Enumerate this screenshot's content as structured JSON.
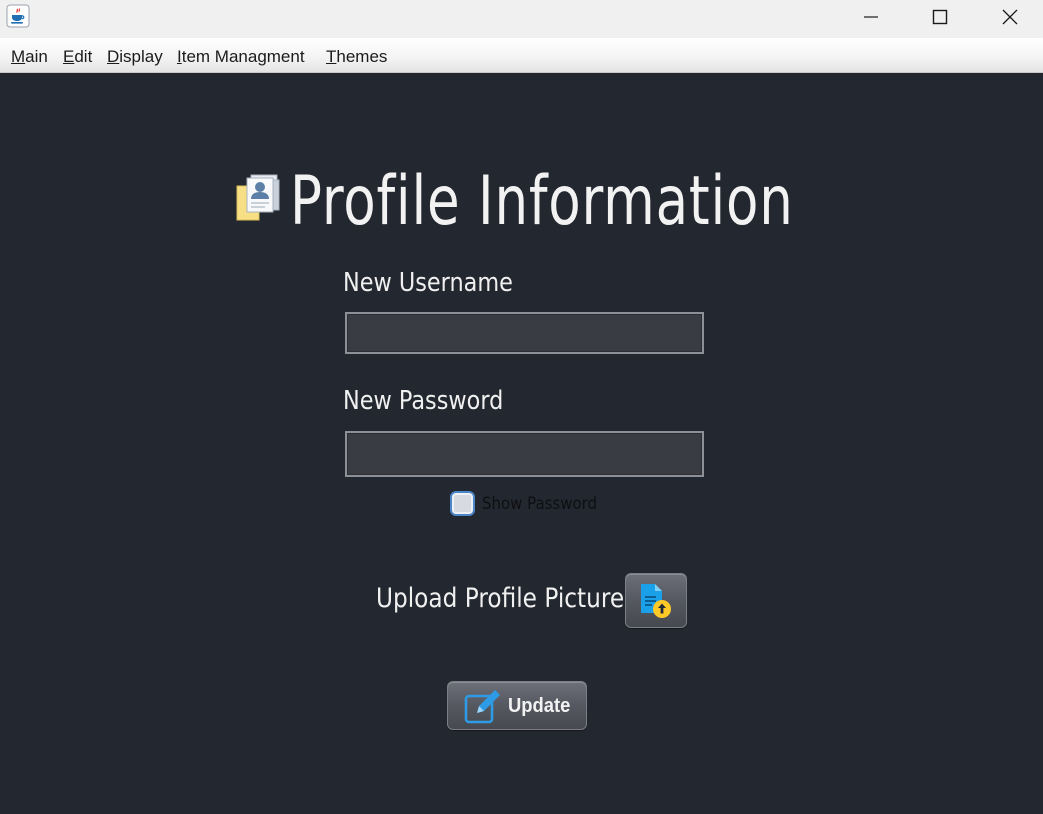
{
  "window": {
    "icon": "java-cup-icon",
    "controls": [
      "minimize-icon",
      "maximize-icon",
      "close-icon"
    ]
  },
  "menubar": {
    "items": [
      {
        "mnemonic": "M",
        "rest": "ain"
      },
      {
        "mnemonic": "E",
        "rest": "dit"
      },
      {
        "mnemonic": "D",
        "rest": "isplay"
      },
      {
        "mnemonic": "I",
        "rest": "tem Managment"
      },
      {
        "mnemonic": "T",
        "rest": "hemes"
      }
    ]
  },
  "form": {
    "heading": "Profile Information",
    "heading_icon": "profile-card-icon",
    "username_label": "New Username",
    "username_value": "",
    "password_label": "New Password",
    "password_value": "",
    "show_password_label": "Show Password",
    "show_password_checked": false,
    "upload_label": "Upload Profile Picture",
    "upload_icon": "file-upload-icon",
    "update_label": "Update",
    "update_icon": "edit-pencil-icon"
  },
  "colors": {
    "background": "#23272f",
    "accent": "#2e9be6"
  }
}
